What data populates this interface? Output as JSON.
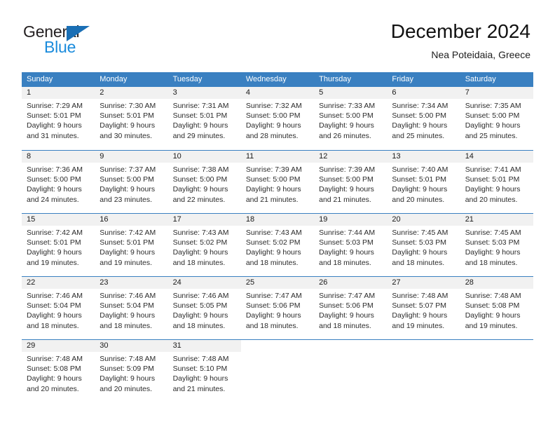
{
  "brand": {
    "name_dark": "General",
    "name_blue": "Blue",
    "accent_blue": "#1a8bdc",
    "triangle_blue": "#1a6fb5"
  },
  "header": {
    "title": "December 2024",
    "subtitle": "Nea Poteidaia, Greece"
  },
  "calendar": {
    "header_bg": "#3a80c1",
    "day_band_bg": "#f1f1f1",
    "weekdays": [
      "Sunday",
      "Monday",
      "Tuesday",
      "Wednesday",
      "Thursday",
      "Friday",
      "Saturday"
    ],
    "weeks": [
      [
        {
          "day": "1",
          "sunrise": "Sunrise: 7:29 AM",
          "sunset": "Sunset: 5:01 PM",
          "daylight1": "Daylight: 9 hours",
          "daylight2": "and 31 minutes."
        },
        {
          "day": "2",
          "sunrise": "Sunrise: 7:30 AM",
          "sunset": "Sunset: 5:01 PM",
          "daylight1": "Daylight: 9 hours",
          "daylight2": "and 30 minutes."
        },
        {
          "day": "3",
          "sunrise": "Sunrise: 7:31 AM",
          "sunset": "Sunset: 5:01 PM",
          "daylight1": "Daylight: 9 hours",
          "daylight2": "and 29 minutes."
        },
        {
          "day": "4",
          "sunrise": "Sunrise: 7:32 AM",
          "sunset": "Sunset: 5:00 PM",
          "daylight1": "Daylight: 9 hours",
          "daylight2": "and 28 minutes."
        },
        {
          "day": "5",
          "sunrise": "Sunrise: 7:33 AM",
          "sunset": "Sunset: 5:00 PM",
          "daylight1": "Daylight: 9 hours",
          "daylight2": "and 26 minutes."
        },
        {
          "day": "6",
          "sunrise": "Sunrise: 7:34 AM",
          "sunset": "Sunset: 5:00 PM",
          "daylight1": "Daylight: 9 hours",
          "daylight2": "and 25 minutes."
        },
        {
          "day": "7",
          "sunrise": "Sunrise: 7:35 AM",
          "sunset": "Sunset: 5:00 PM",
          "daylight1": "Daylight: 9 hours",
          "daylight2": "and 25 minutes."
        }
      ],
      [
        {
          "day": "8",
          "sunrise": "Sunrise: 7:36 AM",
          "sunset": "Sunset: 5:00 PM",
          "daylight1": "Daylight: 9 hours",
          "daylight2": "and 24 minutes."
        },
        {
          "day": "9",
          "sunrise": "Sunrise: 7:37 AM",
          "sunset": "Sunset: 5:00 PM",
          "daylight1": "Daylight: 9 hours",
          "daylight2": "and 23 minutes."
        },
        {
          "day": "10",
          "sunrise": "Sunrise: 7:38 AM",
          "sunset": "Sunset: 5:00 PM",
          "daylight1": "Daylight: 9 hours",
          "daylight2": "and 22 minutes."
        },
        {
          "day": "11",
          "sunrise": "Sunrise: 7:39 AM",
          "sunset": "Sunset: 5:00 PM",
          "daylight1": "Daylight: 9 hours",
          "daylight2": "and 21 minutes."
        },
        {
          "day": "12",
          "sunrise": "Sunrise: 7:39 AM",
          "sunset": "Sunset: 5:00 PM",
          "daylight1": "Daylight: 9 hours",
          "daylight2": "and 21 minutes."
        },
        {
          "day": "13",
          "sunrise": "Sunrise: 7:40 AM",
          "sunset": "Sunset: 5:01 PM",
          "daylight1": "Daylight: 9 hours",
          "daylight2": "and 20 minutes."
        },
        {
          "day": "14",
          "sunrise": "Sunrise: 7:41 AM",
          "sunset": "Sunset: 5:01 PM",
          "daylight1": "Daylight: 9 hours",
          "daylight2": "and 20 minutes."
        }
      ],
      [
        {
          "day": "15",
          "sunrise": "Sunrise: 7:42 AM",
          "sunset": "Sunset: 5:01 PM",
          "daylight1": "Daylight: 9 hours",
          "daylight2": "and 19 minutes."
        },
        {
          "day": "16",
          "sunrise": "Sunrise: 7:42 AM",
          "sunset": "Sunset: 5:01 PM",
          "daylight1": "Daylight: 9 hours",
          "daylight2": "and 19 minutes."
        },
        {
          "day": "17",
          "sunrise": "Sunrise: 7:43 AM",
          "sunset": "Sunset: 5:02 PM",
          "daylight1": "Daylight: 9 hours",
          "daylight2": "and 18 minutes."
        },
        {
          "day": "18",
          "sunrise": "Sunrise: 7:43 AM",
          "sunset": "Sunset: 5:02 PM",
          "daylight1": "Daylight: 9 hours",
          "daylight2": "and 18 minutes."
        },
        {
          "day": "19",
          "sunrise": "Sunrise: 7:44 AM",
          "sunset": "Sunset: 5:03 PM",
          "daylight1": "Daylight: 9 hours",
          "daylight2": "and 18 minutes."
        },
        {
          "day": "20",
          "sunrise": "Sunrise: 7:45 AM",
          "sunset": "Sunset: 5:03 PM",
          "daylight1": "Daylight: 9 hours",
          "daylight2": "and 18 minutes."
        },
        {
          "day": "21",
          "sunrise": "Sunrise: 7:45 AM",
          "sunset": "Sunset: 5:03 PM",
          "daylight1": "Daylight: 9 hours",
          "daylight2": "and 18 minutes."
        }
      ],
      [
        {
          "day": "22",
          "sunrise": "Sunrise: 7:46 AM",
          "sunset": "Sunset: 5:04 PM",
          "daylight1": "Daylight: 9 hours",
          "daylight2": "and 18 minutes."
        },
        {
          "day": "23",
          "sunrise": "Sunrise: 7:46 AM",
          "sunset": "Sunset: 5:04 PM",
          "daylight1": "Daylight: 9 hours",
          "daylight2": "and 18 minutes."
        },
        {
          "day": "24",
          "sunrise": "Sunrise: 7:46 AM",
          "sunset": "Sunset: 5:05 PM",
          "daylight1": "Daylight: 9 hours",
          "daylight2": "and 18 minutes."
        },
        {
          "day": "25",
          "sunrise": "Sunrise: 7:47 AM",
          "sunset": "Sunset: 5:06 PM",
          "daylight1": "Daylight: 9 hours",
          "daylight2": "and 18 minutes."
        },
        {
          "day": "26",
          "sunrise": "Sunrise: 7:47 AM",
          "sunset": "Sunset: 5:06 PM",
          "daylight1": "Daylight: 9 hours",
          "daylight2": "and 18 minutes."
        },
        {
          "day": "27",
          "sunrise": "Sunrise: 7:48 AM",
          "sunset": "Sunset: 5:07 PM",
          "daylight1": "Daylight: 9 hours",
          "daylight2": "and 19 minutes."
        },
        {
          "day": "28",
          "sunrise": "Sunrise: 7:48 AM",
          "sunset": "Sunset: 5:08 PM",
          "daylight1": "Daylight: 9 hours",
          "daylight2": "and 19 minutes."
        }
      ],
      [
        {
          "day": "29",
          "sunrise": "Sunrise: 7:48 AM",
          "sunset": "Sunset: 5:08 PM",
          "daylight1": "Daylight: 9 hours",
          "daylight2": "and 20 minutes."
        },
        {
          "day": "30",
          "sunrise": "Sunrise: 7:48 AM",
          "sunset": "Sunset: 5:09 PM",
          "daylight1": "Daylight: 9 hours",
          "daylight2": "and 20 minutes."
        },
        {
          "day": "31",
          "sunrise": "Sunrise: 7:48 AM",
          "sunset": "Sunset: 5:10 PM",
          "daylight1": "Daylight: 9 hours",
          "daylight2": "and 21 minutes."
        },
        {
          "day": "",
          "sunrise": "",
          "sunset": "",
          "daylight1": "",
          "daylight2": ""
        },
        {
          "day": "",
          "sunrise": "",
          "sunset": "",
          "daylight1": "",
          "daylight2": ""
        },
        {
          "day": "",
          "sunrise": "",
          "sunset": "",
          "daylight1": "",
          "daylight2": ""
        },
        {
          "day": "",
          "sunrise": "",
          "sunset": "",
          "daylight1": "",
          "daylight2": ""
        }
      ]
    ]
  }
}
